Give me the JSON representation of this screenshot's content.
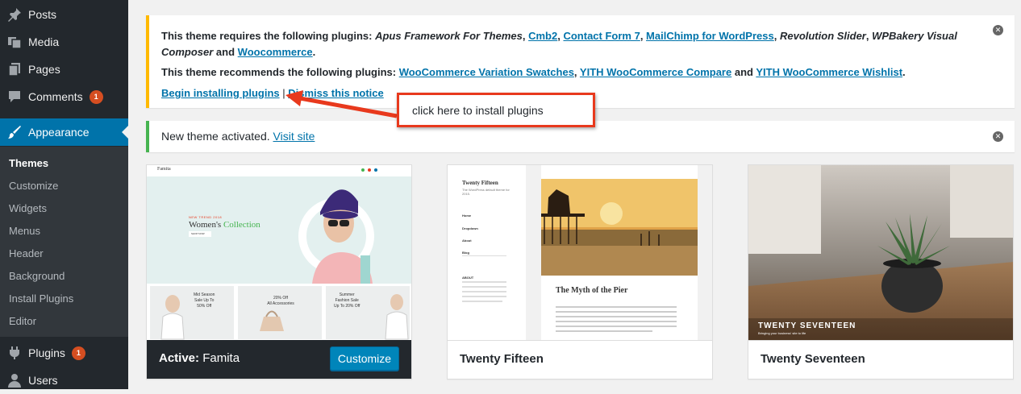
{
  "sidebar": {
    "items": [
      {
        "label": "Posts",
        "icon": "pin-icon"
      },
      {
        "label": "Media",
        "icon": "media-icon"
      },
      {
        "label": "Pages",
        "icon": "pages-icon"
      },
      {
        "label": "Comments",
        "icon": "comment-icon",
        "badge": "1"
      },
      {
        "label": "Appearance",
        "icon": "paintbrush-icon"
      },
      {
        "label": "Plugins",
        "icon": "plug-icon",
        "badge": "1"
      },
      {
        "label": "Users",
        "icon": "user-icon"
      }
    ],
    "submenu": [
      "Themes",
      "Customize",
      "Widgets",
      "Menus",
      "Header",
      "Background",
      "Install Plugins",
      "Editor"
    ]
  },
  "notice_plugins": {
    "required_prefix": "This theme requires the following plugins:",
    "req1": "Apus Framework For Themes",
    "req2": "Cmb2",
    "req3": "Contact Form 7",
    "req4": "MailChimp for WordPress",
    "req5": "Revolution Slider",
    "req6": "WPBakery Visual",
    "req6b": "Composer",
    "and1": "and",
    "req7": "Woocommerce",
    "recommended_prefix": "This theme recommends the following plugins:",
    "rec1": "WooCommerce Variation Swatches",
    "rec2": "YITH WooCommerce Compare",
    "and2": "and",
    "rec3": "YITH WooCommerce Wishlist",
    "begin_link": "Begin installing plugins",
    "separator": "|",
    "dismiss_link": "Dismiss this notice"
  },
  "notice_activated": {
    "text": "New theme activated.",
    "link": "Visit site"
  },
  "callout": "click here to install plugins",
  "themes": [
    {
      "active_label": "Active:",
      "name": "Famita",
      "button": "Customize",
      "shot": {
        "brand": "Famita",
        "tag": "NEW TREND 2018",
        "headline1": "Women's",
        "headline2": "Collection",
        "cta": "SHOP NOW",
        "promos": [
          [
            "Mid Season",
            "Sale Up To",
            "50% Off"
          ],
          [
            "20% Off",
            "All Accessories"
          ],
          [
            "Summer",
            "Fashion Sale",
            "Up To 20% Off"
          ]
        ]
      }
    },
    {
      "name": "Twenty Fifteen",
      "shot": {
        "site_title": "Twenty Fifteen",
        "tagline": "The WordPress default theme for 2015.",
        "nav": [
          "Home",
          "Dropdown",
          "About",
          "Blog"
        ],
        "about": "ABOUT",
        "post_title": "The Myth of the Pier"
      }
    },
    {
      "name": "Twenty Seventeen",
      "shot": {
        "site_title": "TWENTY SEVENTEEN",
        "tagline": "Bringing your business' site to life"
      }
    }
  ]
}
